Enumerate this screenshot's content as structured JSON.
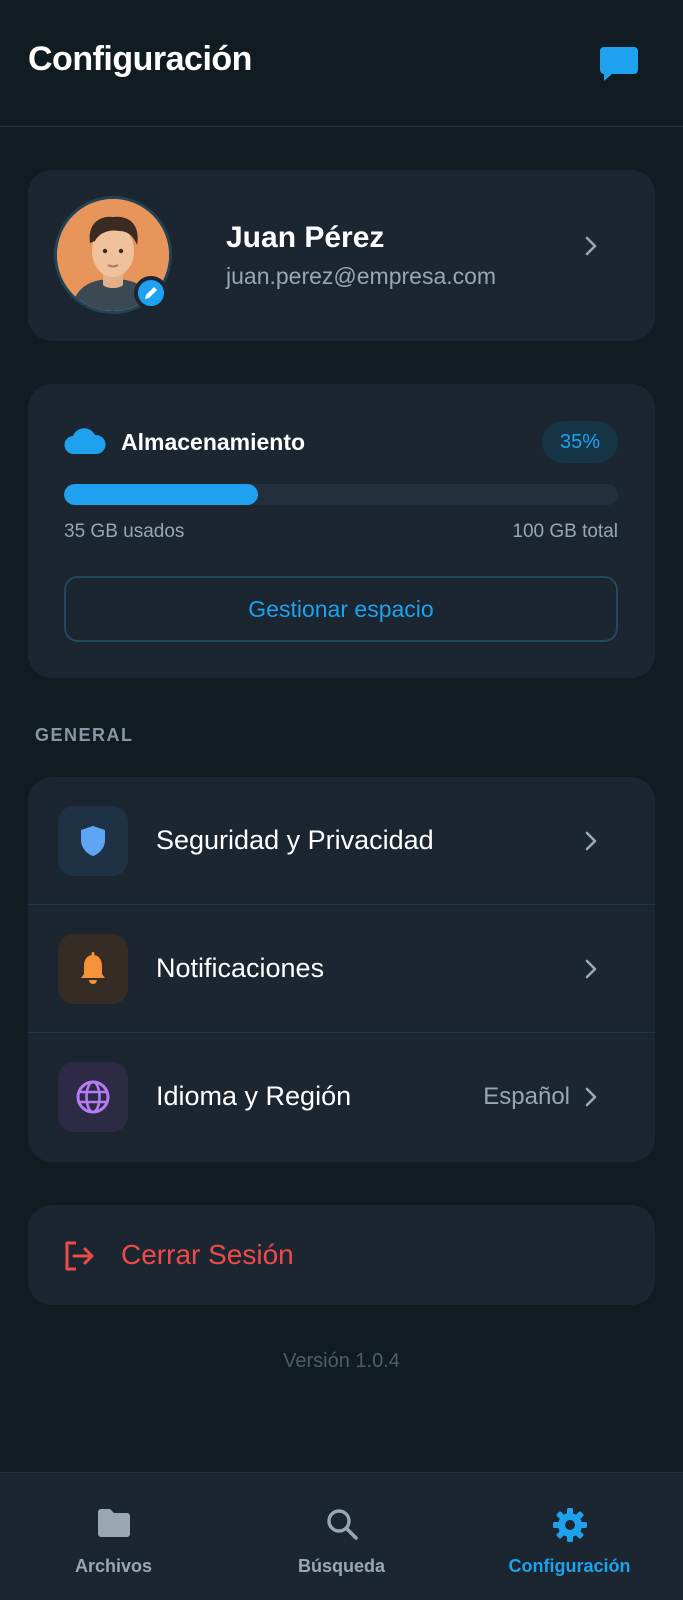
{
  "header": {
    "title": "Configuración",
    "chat_icon": "chat-bubble-icon"
  },
  "profile": {
    "name": "Juan Pérez",
    "email": "juan.perez@empresa.com",
    "avatar_icon": "avatar-illustration",
    "edit_icon": "pencil-icon"
  },
  "storage": {
    "title": "Almacenamiento",
    "percent_label": "35%",
    "percent_value": 0.35,
    "used": "35 GB usados",
    "total": "100 GB total",
    "manage_label": "Gestionar espacio",
    "icon": "cloud-icon"
  },
  "general": {
    "section_label": "GENERAL",
    "items": [
      {
        "label": "Seguridad y Privacidad",
        "icon": "shield-icon",
        "value": ""
      },
      {
        "label": "Notificaciones",
        "icon": "bell-icon",
        "value": ""
      },
      {
        "label": "Idioma y Región",
        "icon": "globe-icon",
        "value": "Español"
      }
    ]
  },
  "logout": {
    "label": "Cerrar Sesión",
    "icon": "logout-icon"
  },
  "version": "Versión 1.0.4",
  "bottom_nav": {
    "items": [
      {
        "label": "Archivos",
        "icon": "folder-icon",
        "active": false
      },
      {
        "label": "Búsqueda",
        "icon": "search-icon",
        "active": false
      },
      {
        "label": "Configuración",
        "icon": "gear-icon",
        "active": true
      }
    ]
  },
  "colors": {
    "background": "#111b22",
    "card": "#1b2630",
    "accent": "#1ea1ee",
    "danger": "#ef4a4a",
    "muted_text": "#9aa7b1"
  }
}
